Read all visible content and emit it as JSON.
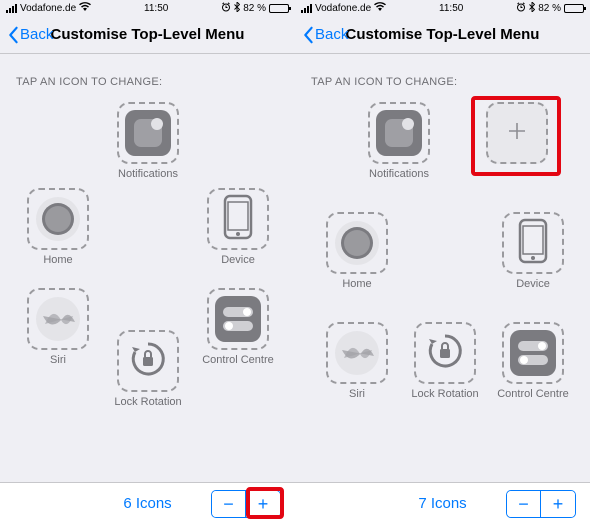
{
  "status": {
    "carrier": "Vodafone.de",
    "time": "11:50",
    "battery": "82 %",
    "alarm": "⏰",
    "bluetooth": "✱"
  },
  "nav": {
    "back": "Back",
    "title": "Customise Top-Level Menu"
  },
  "section_label": "TAP AN ICON TO CHANGE:",
  "icons": {
    "notifications": "Notifications",
    "home": "Home",
    "device": "Device",
    "siri": "Siri",
    "lock_rotation": "Lock Rotation",
    "control_centre": "Control Centre",
    "empty": ""
  },
  "left": {
    "count": "6 Icons",
    "minus": "−",
    "plus": "+"
  },
  "right": {
    "count": "7 Icons",
    "minus": "−",
    "plus": "+"
  }
}
